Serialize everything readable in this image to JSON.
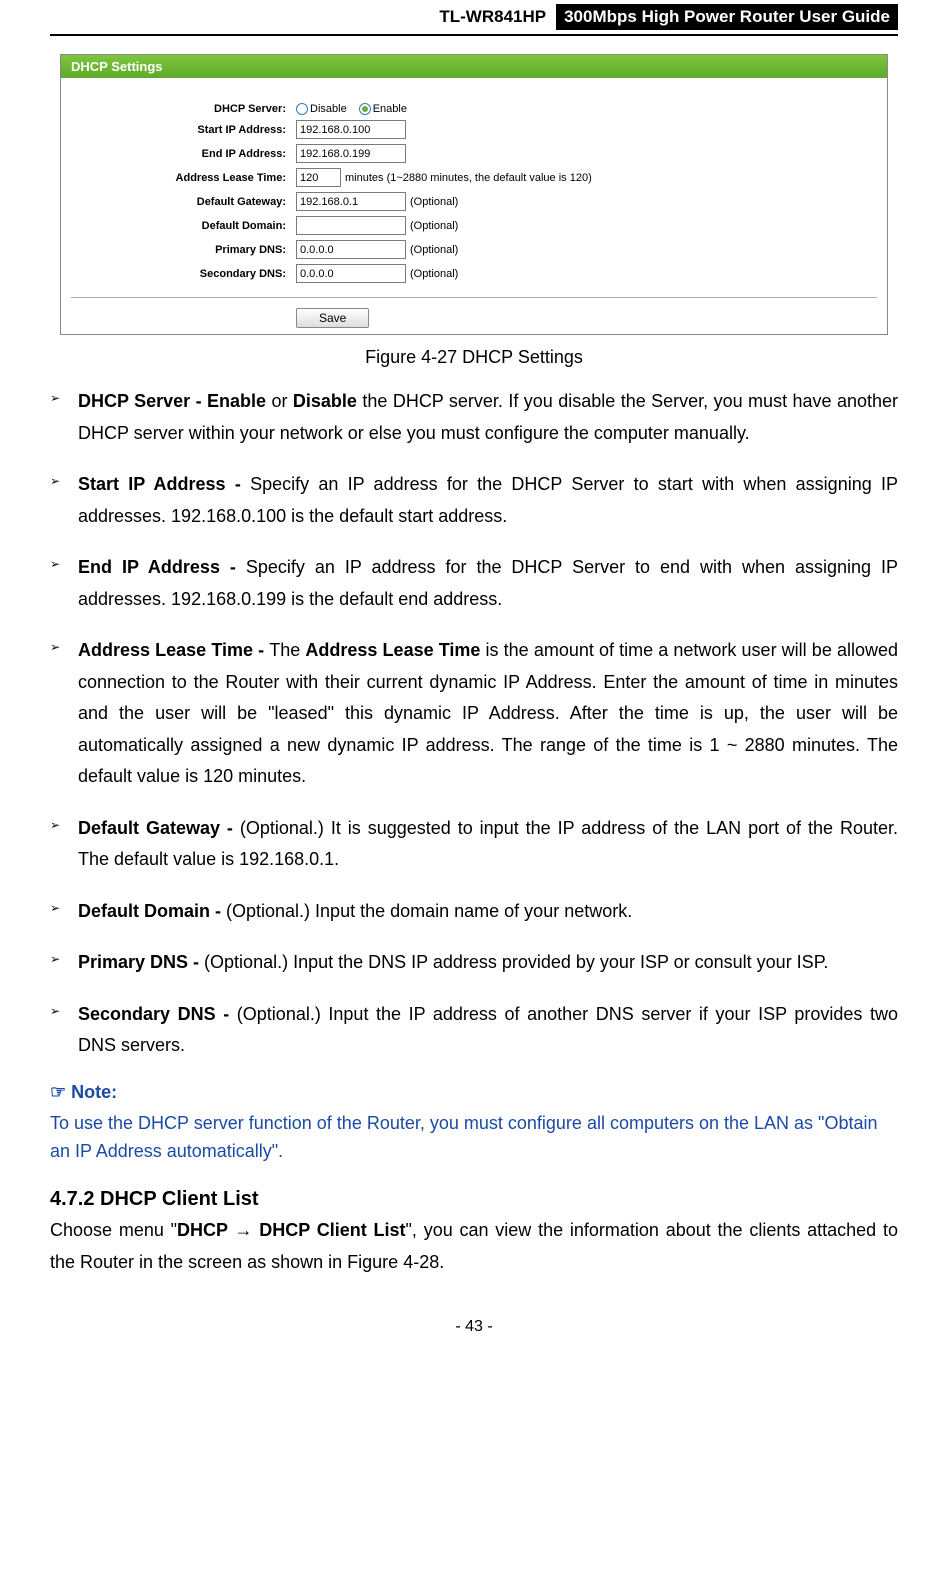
{
  "header": {
    "model": "TL-WR841HP",
    "title": "300Mbps High Power Router User Guide"
  },
  "screenshot": {
    "title": "DHCP Settings",
    "fields": {
      "dhcp_server": {
        "label": "DHCP Server:",
        "disable": "Disable",
        "enable": "Enable"
      },
      "start_ip": {
        "label": "Start IP Address:",
        "value": "192.168.0.100"
      },
      "end_ip": {
        "label": "End IP Address:",
        "value": "192.168.0.199"
      },
      "lease": {
        "label": "Address Lease Time:",
        "value": "120",
        "suffix": "minutes (1~2880 minutes, the default value is 120)"
      },
      "gateway": {
        "label": "Default Gateway:",
        "value": "192.168.0.1",
        "optional": "(Optional)"
      },
      "domain": {
        "label": "Default Domain:",
        "value": "",
        "optional": "(Optional)"
      },
      "primary_dns": {
        "label": "Primary DNS:",
        "value": "0.0.0.0",
        "optional": "(Optional)"
      },
      "secondary_dns": {
        "label": "Secondary DNS:",
        "value": "0.0.0.0",
        "optional": "(Optional)"
      }
    },
    "save": "Save"
  },
  "figure_caption": "Figure 4-27 DHCP Settings",
  "bullets": {
    "b1_bold1": "DHCP Server - Enable",
    "b1_mid": " or ",
    "b1_bold2": "Disable",
    "b1_rest": " the DHCP server. If you disable the Server, you must have another DHCP server within your network or else you must configure the computer manually.",
    "b2_bold": "Start IP Address - ",
    "b2_rest": "Specify an IP address for the DHCP Server to start with when assigning IP addresses. 192.168.0.100 is the default start address.",
    "b3_bold": "End IP Address - ",
    "b3_rest": "Specify an IP address for the DHCP Server to end with when assigning IP addresses. 192.168.0.199 is the default end address.",
    "b4_bold1": "Address Lease Time - ",
    "b4_mid1": "The ",
    "b4_bold2": "Address Lease Time",
    "b4_rest": " is the amount of time a network user will be allowed connection to the Router with their current dynamic IP Address. Enter the amount of time in minutes and the user will be \"leased\" this dynamic IP Address. After the time is up, the user will be automatically assigned a new dynamic IP address. The range of the time is 1 ~ 2880 minutes. The default value is 120 minutes.",
    "b5_bold": "Default Gateway - ",
    "b5_rest": "(Optional.) It is suggested to input the IP address of the LAN port of the Router. The default value is 192.168.0.1.",
    "b6_bold": "Default Domain - ",
    "b6_rest": "(Optional.) Input the domain name of your network.",
    "b7_bold": "Primary DNS - ",
    "b7_rest": "(Optional.) Input the DNS IP address provided by your ISP or consult your ISP.",
    "b8_bold": "Secondary DNS - ",
    "b8_rest": "(Optional.) Input the IP address of another DNS server if your ISP provides two DNS servers."
  },
  "note": {
    "icon": "☞",
    "label": " Note:",
    "body": "To use the DHCP server function of the Router, you must configure all computers on the LAN as \"Obtain an IP Address automatically\"."
  },
  "section": {
    "heading": "4.7.2  DHCP Client List",
    "pre": "Choose menu \"",
    "bold": "DHCP → DHCP Client List",
    "post": "\", you can view the information about the clients attached to the Router in the screen as shown in Figure 4-28."
  },
  "page_number": "- 43 -"
}
